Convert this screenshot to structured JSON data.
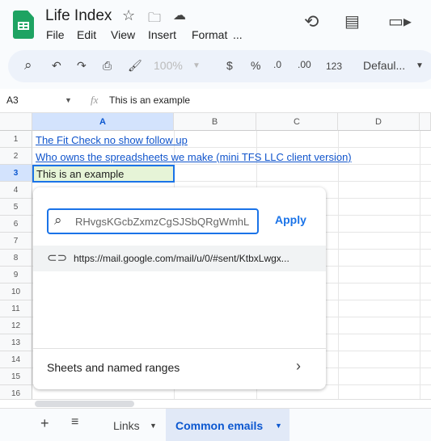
{
  "app": {
    "title": "Life Index",
    "menu": [
      "File",
      "Edit",
      "View",
      "Insert",
      "Format",
      "..."
    ]
  },
  "toolbar": {
    "zoom": "100%",
    "currency": "$",
    "percent": "%",
    "dec_decrease": ".0",
    "dec_increase": ".00",
    "number_format": "123",
    "font": "Defaul..."
  },
  "formula_bar": {
    "cell_ref": "A3",
    "fx": "fx",
    "value": "This is an example"
  },
  "grid": {
    "columns": [
      "A",
      "B",
      "C",
      "D"
    ],
    "rows": [
      "1",
      "2",
      "3",
      "4",
      "5",
      "6",
      "7",
      "8",
      "9",
      "10",
      "11",
      "12",
      "13",
      "14",
      "15",
      "16"
    ],
    "cells": {
      "A1": "The Fit Check no show follow up",
      "A2": "Who owns the spreadsheets we make (mini TFS LLC client version)",
      "A3": "This is an example"
    }
  },
  "link_popup": {
    "search_value": "RHvgsKGcbZxmzCgSJSbQRgWmhL",
    "apply": "Apply",
    "suggestion": "https://mail.google.com/mail/u/0/#sent/KtbxLwgx...",
    "sheets_ranges": "Sheets and named ranges"
  },
  "sheet_tabs": {
    "tabs": [
      "Links",
      "Common emails"
    ],
    "active": "Common emails"
  },
  "colors": {
    "accent": "#0b57d0",
    "link": "#1155cc",
    "selected_tab_bg": "#e1e9f7"
  }
}
